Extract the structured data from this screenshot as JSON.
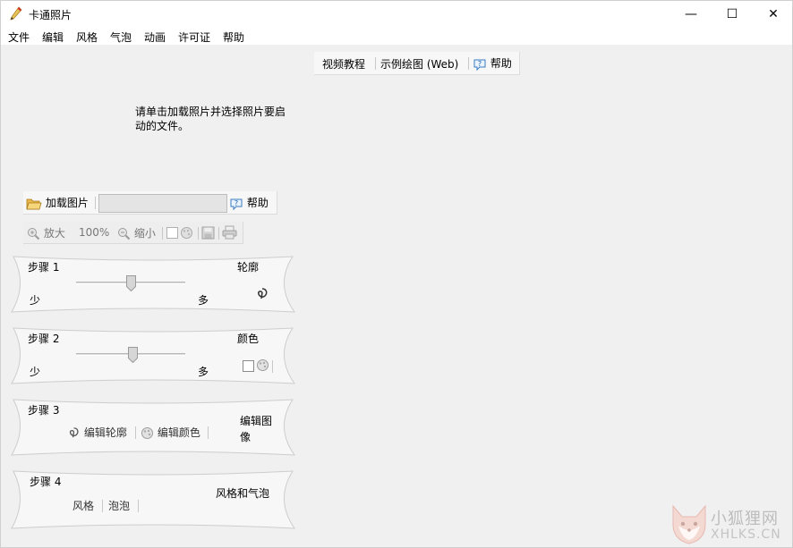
{
  "window": {
    "title": "卡通照片",
    "minimize": "—",
    "maximize": "☐",
    "close": "✕"
  },
  "menu": [
    "文件",
    "编辑",
    "风格",
    "气泡",
    "动画",
    "许可证",
    "帮助"
  ],
  "top_toolbar": {
    "video_tutorial": "视频教程",
    "sample_drawing": "示例绘图 (Web)",
    "help": "帮助"
  },
  "hint": "请单击加载照片并选择照片要启动的文件。",
  "load_bar": {
    "load_label": "加载图片",
    "file_value": "",
    "help_label": "帮助"
  },
  "zoom_bar": {
    "zoom_in": "放大",
    "zoom_level": "100%",
    "zoom_out": "缩小"
  },
  "steps": [
    {
      "title": "步骤 1",
      "right_label": "轮廓",
      "min_label": "少",
      "max_label": "多",
      "slider_level": 0.5
    },
    {
      "title": "步骤 2",
      "right_label": "颜色",
      "min_label": "少",
      "max_label": "多",
      "slider_level": 0.52
    },
    {
      "title": "步骤 3",
      "edit_outline": "编辑轮廓",
      "edit_color": "编辑颜色",
      "right_label": "编辑图像"
    },
    {
      "title": "步骤 4",
      "style": "风格",
      "bubble": "泡泡",
      "right_label": "风格和气泡"
    }
  ],
  "watermark": {
    "cn": "小狐狸网",
    "en": "XHLKS.CN"
  }
}
